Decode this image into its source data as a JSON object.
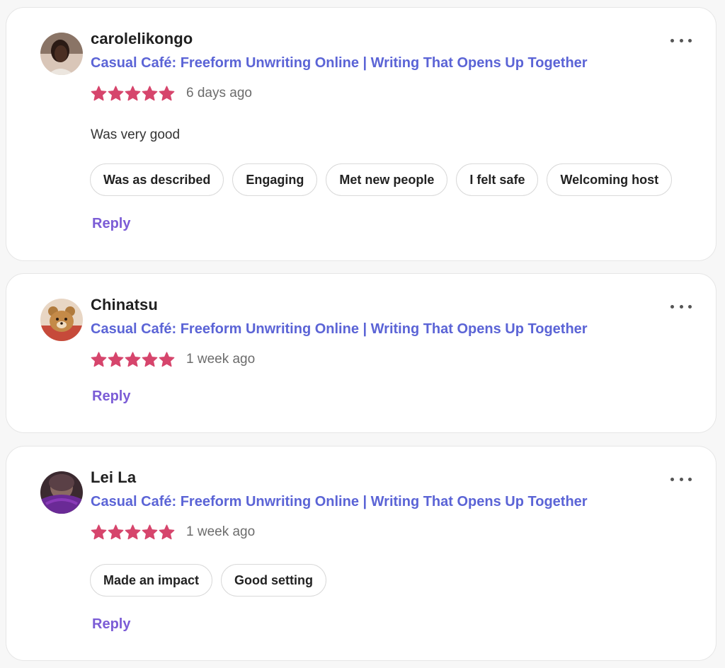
{
  "reviews": [
    {
      "username": "carolelikongo",
      "event_title": "Casual Café: Freeform Unwriting Online | Writing That Opens Up Together",
      "rating": 5,
      "date": "6 days ago",
      "text": "Was very good",
      "tags": [
        "Was as described",
        "Engaging",
        "Met new people",
        "I felt safe",
        "Welcoming host"
      ],
      "reply_label": "Reply"
    },
    {
      "username": "Chinatsu",
      "event_title": "Casual Café: Freeform Unwriting Online | Writing That Opens Up Together",
      "rating": 5,
      "date": "1 week ago",
      "reply_label": "Reply"
    },
    {
      "username": "Lei La",
      "event_title": "Casual Café: Freeform Unwriting Online | Writing That Opens Up Together",
      "rating": 5,
      "date": "1 week ago",
      "tags": [
        "Made an impact",
        "Good setting"
      ],
      "reply_label": "Reply"
    }
  ],
  "colors": {
    "event_link": "#5b64d6",
    "star": "#d6456c",
    "reply": "#7b5cd6"
  },
  "icons": {
    "more": "more-horizontal-icon",
    "star": "star-icon"
  }
}
